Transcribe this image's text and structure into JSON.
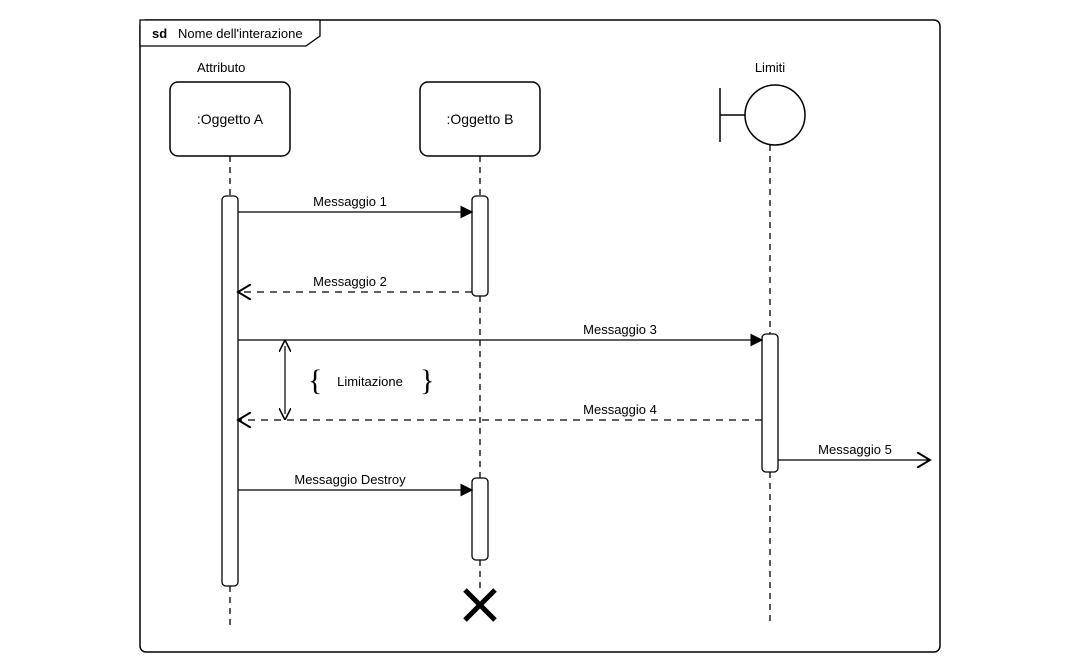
{
  "frame": {
    "tag": "sd",
    "title": "Nome dell'interazione"
  },
  "participants": {
    "a": {
      "label": ":Oggetto A",
      "caption": "Attributo"
    },
    "b": {
      "label": ":Oggetto B"
    },
    "c": {
      "label": "Limiti"
    }
  },
  "messages": {
    "m1": "Messaggio 1",
    "m2": "Messaggio 2",
    "m3": "Messaggio 3",
    "m4": "Messaggio 4",
    "m5": "Messaggio 5",
    "mdestroy": "Messaggio Destroy"
  },
  "constraint": {
    "label": "Limitazione"
  }
}
